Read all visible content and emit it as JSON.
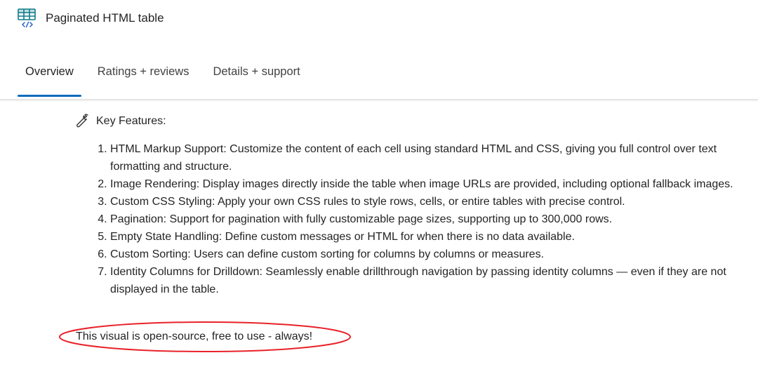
{
  "app": {
    "title": "Paginated HTML table",
    "icon": "table-code-icon"
  },
  "tabs": [
    {
      "label": "Overview",
      "active": true
    },
    {
      "label": "Ratings + reviews",
      "active": false
    },
    {
      "label": "Details + support",
      "active": false
    }
  ],
  "content": {
    "heading_icon": "wrench-icon",
    "heading": "Key Features:",
    "features": [
      "HTML Markup Support: Customize the content of each cell using standard HTML and CSS, giving you full control over text formatting and structure.",
      "Image Rendering: Display images directly inside the table when image URLs are provided, including optional fallback images.",
      "Custom CSS Styling: Apply your own CSS rules to style rows, cells, or entire tables with precise control.",
      "Pagination: Support for pagination with fully customizable page sizes, supporting up to 300,000 rows.",
      "Empty State Handling: Define custom messages or HTML for when there is no data available.",
      "Custom Sorting: Users can define custom sorting for columns by columns or measures.",
      "Identity Columns for Drilldown: Seamlessly enable drillthrough navigation by passing identity columns — even if they are not displayed in the table."
    ],
    "note": "This visual is open-source, free to use - always!"
  },
  "colors": {
    "accent": "#0f6cbd",
    "icon_teal": "#0f7b8a",
    "highlight": "#e8222a"
  }
}
